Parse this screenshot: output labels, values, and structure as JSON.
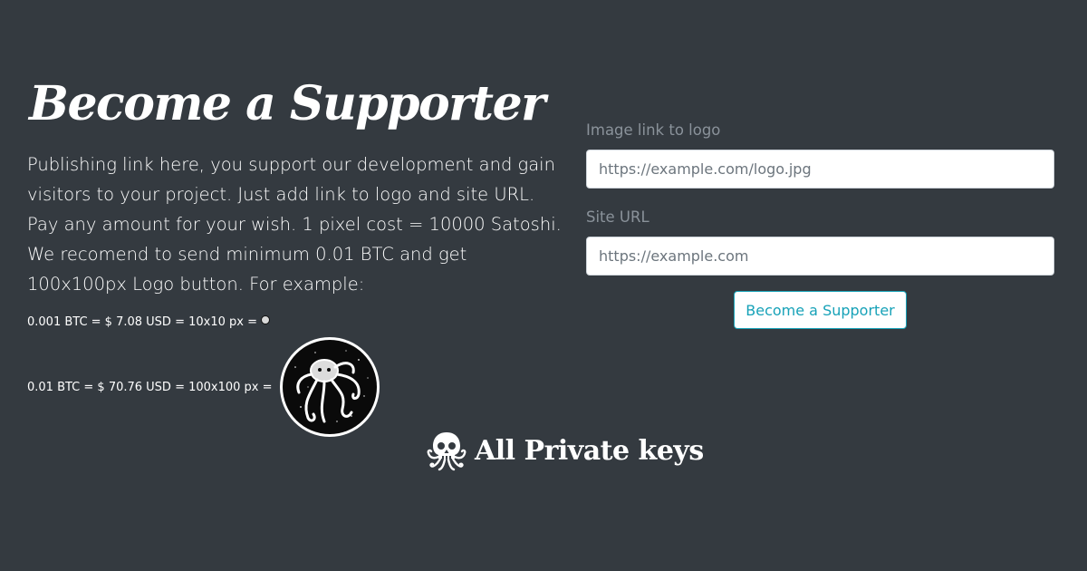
{
  "hero": {
    "title": "Become a Supporter",
    "intro_lines": [
      "Publishing link here, you support our development and gain visitors to your project. Just add link to logo and site URL. Pay any amount for your wish. 1 pixel cost = 10000 Satoshi.",
      "We recomend to send minimum 0.01 BTC and get 100x100px Logo button. For example:"
    ]
  },
  "examples": [
    {
      "text": "0.001 BTC = $ 7.08 USD = 10x10 px ="
    },
    {
      "text": "0.01 BTC = $ 70.76 USD = 100x100 px ="
    }
  ],
  "form": {
    "logo_label": "Image link to logo",
    "logo_placeholder": "https://example.com/logo.jpg",
    "site_label": "Site URL",
    "site_placeholder": "https://example.com",
    "submit_label": "Become a Supporter"
  },
  "brand": {
    "name": "All Private keys",
    "icon": "octopus-skull-icon"
  },
  "colors": {
    "background": "#343a40",
    "accent": "#17a2b8",
    "label": "#8a929a"
  }
}
